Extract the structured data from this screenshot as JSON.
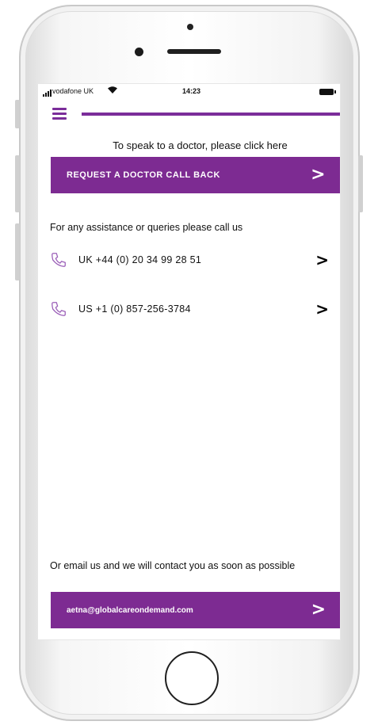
{
  "status": {
    "carrier": "vodafone UK",
    "time": "14:23"
  },
  "header": {
    "menu_icon": "hamburger-menu-icon"
  },
  "doctor": {
    "prompt": "To speak to a doctor, please click here",
    "button_label": "REQUEST A DOCTOR CALL BACK"
  },
  "assistance": {
    "heading": "For any assistance or queries please call us",
    "phones": [
      {
        "label": "UK +44 (0) 20 34 99 28 51",
        "icon": "phone-icon"
      },
      {
        "label": "US +1 (0) 857-256-3784",
        "icon": "phone-icon"
      }
    ]
  },
  "email": {
    "prompt": "Or email us and we will contact you as soon as possible",
    "button_label": "aetna@globalcareondemand.com"
  },
  "colors": {
    "accent": "#7d2b92"
  }
}
